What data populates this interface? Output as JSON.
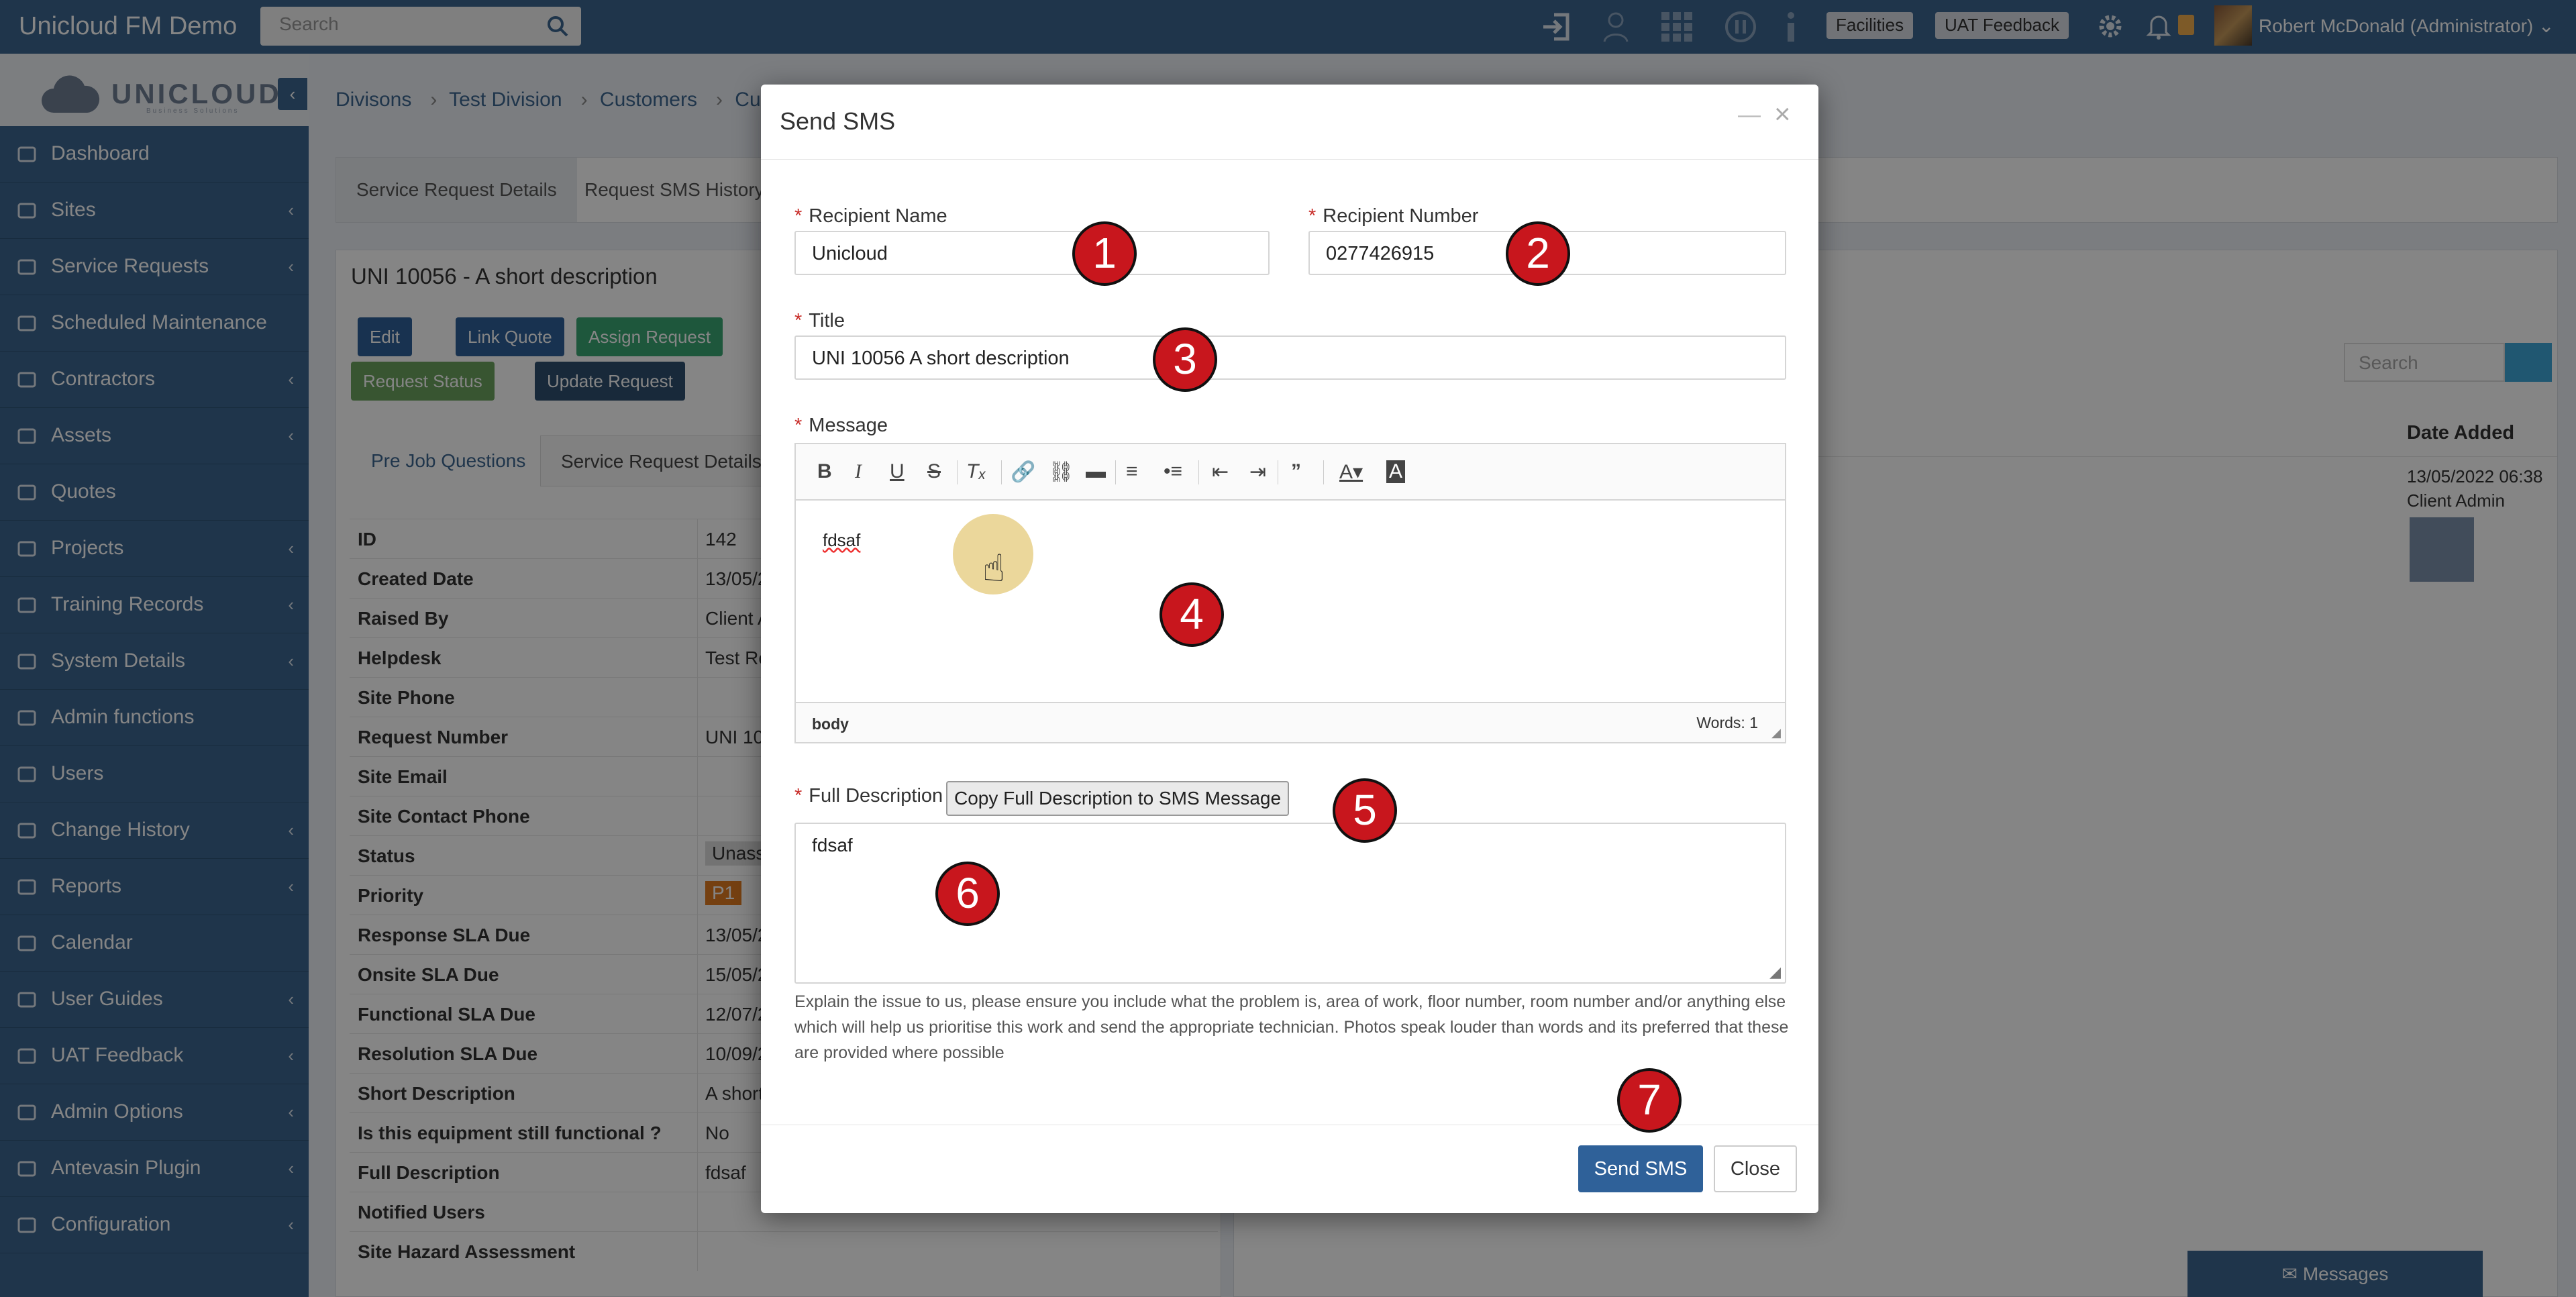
{
  "app": {
    "title": "Unicloud FM Demo",
    "search_placeholder": "Search",
    "facilities_label": "Facilities",
    "uat_feedback_label": "UAT Feedback",
    "user_label": "Robert McDonald (Administrator)"
  },
  "logo": {
    "name": "UNICLOUD",
    "tagline": "Business Solutions"
  },
  "sidebar": {
    "items": [
      {
        "label": "Dashboard",
        "icon": "home-icon",
        "chevron": false
      },
      {
        "label": "Sites",
        "icon": "building-icon",
        "chevron": true
      },
      {
        "label": "Service Requests",
        "icon": "wrench-icon",
        "chevron": true
      },
      {
        "label": "Scheduled Maintenance",
        "icon": "calendar-icon",
        "chevron": false
      },
      {
        "label": "Contractors",
        "icon": "users-icon",
        "chevron": true
      },
      {
        "label": "Assets",
        "icon": "asset-icon",
        "chevron": true
      },
      {
        "label": "Quotes",
        "icon": "tags-icon",
        "chevron": false
      },
      {
        "label": "Projects",
        "icon": "check-square-icon",
        "chevron": true
      },
      {
        "label": "Training Records",
        "icon": "graduation-cap-icon",
        "chevron": true
      },
      {
        "label": "System Details",
        "icon": "monitor-icon",
        "chevron": true
      },
      {
        "label": "Admin functions",
        "icon": "bars-icon",
        "chevron": false
      },
      {
        "label": "Users",
        "icon": "users-icon",
        "chevron": false
      },
      {
        "label": "Change History",
        "icon": "clock-icon",
        "chevron": true
      },
      {
        "label": "Reports",
        "icon": "bar-chart-icon",
        "chevron": true
      },
      {
        "label": "Calendar",
        "icon": "calendar-icon",
        "chevron": false
      },
      {
        "label": "User Guides",
        "icon": "folder-icon",
        "chevron": true
      },
      {
        "label": "UAT Feedback",
        "icon": "folder-icon",
        "chevron": true
      },
      {
        "label": "Admin Options",
        "icon": "plug-icon",
        "chevron": true
      },
      {
        "label": "Antevasin Plugin",
        "icon": "plug-icon",
        "chevron": true
      },
      {
        "label": "Configuration",
        "icon": "gear-icon",
        "chevron": true
      }
    ]
  },
  "breadcrumb": [
    "Divisons",
    "Test Division",
    "Customers",
    "Custom"
  ],
  "top_tabs": [
    "Service Request Details",
    "Request SMS History"
  ],
  "request": {
    "title": "UNI 10056 - A short description",
    "buttons": {
      "edit": "Edit",
      "link_quote": "Link Quote",
      "assign": "Assign Request",
      "status": "Request Status",
      "update": "Update Request"
    },
    "subtabs": [
      "Pre Job Questions",
      "Service Request Details"
    ],
    "details": [
      {
        "k": "ID",
        "v": "142"
      },
      {
        "k": "Created Date",
        "v": "13/05/2"
      },
      {
        "k": "Raised By",
        "v": "Client A"
      },
      {
        "k": "Helpdesk",
        "v": "Test Re"
      },
      {
        "k": "Site Phone",
        "v": ""
      },
      {
        "k": "Request Number",
        "v": "UNI 10"
      },
      {
        "k": "Site Email",
        "v": ""
      },
      {
        "k": "Site Contact Phone",
        "v": ""
      },
      {
        "k": "Status",
        "v": "Unass"
      },
      {
        "k": "Priority",
        "v": "P1"
      },
      {
        "k": "Response SLA Due",
        "v": "13/05/2"
      },
      {
        "k": "Onsite SLA Due",
        "v": "15/05/2"
      },
      {
        "k": "Functional SLA Due",
        "v": "12/07/2"
      },
      {
        "k": "Resolution SLA Due",
        "v": "10/09/2"
      },
      {
        "k": "Short Description",
        "v": "A short"
      },
      {
        "k": "Is this equipment still functional ?",
        "v": "No"
      },
      {
        "k": "Full Description",
        "v": "fdsaf"
      },
      {
        "k": "Notified Users",
        "v": ""
      },
      {
        "k": "Site Hazard Assessment",
        "v": ""
      }
    ]
  },
  "right_panel": {
    "search_placeholder": "Search",
    "date_added_header": "Date Added",
    "date_added_value": "13/05/2022 06:38",
    "added_by": "Client Admin"
  },
  "messages_label": "Messages",
  "modal": {
    "title": "Send SMS",
    "recipient_name_label": "Recipient Name",
    "recipient_name_value": "Unicloud",
    "recipient_number_label": "Recipient Number",
    "recipient_number_value": "0277426915",
    "title_label": "Title",
    "title_value": "UNI 10056 A short description",
    "message_label": "Message",
    "message_value": "fdsaf",
    "editor_path": "body",
    "editor_words": "Words: 1",
    "full_description_label": "Full Description",
    "copy_button": "Copy Full Description to SMS Message",
    "full_description_value": "fdsaf",
    "help_text": "Explain the issue to us, please ensure you include what the problem is, area of work, floor number, room number and/or anything else which will help us prioritise this work and send the appropriate technician. Photos speak louder than words and its preferred that these are provided where possible",
    "send_button": "Send SMS",
    "close_button": "Close"
  },
  "markers": [
    "1",
    "2",
    "3",
    "4",
    "5",
    "6",
    "7"
  ],
  "colors": {
    "primary": "#3c6690",
    "modal_primary_button": "#2f6199",
    "marker": "#c8161d",
    "success": "#3d9970",
    "assign": "#3aa774",
    "priority": "#e07b22"
  }
}
